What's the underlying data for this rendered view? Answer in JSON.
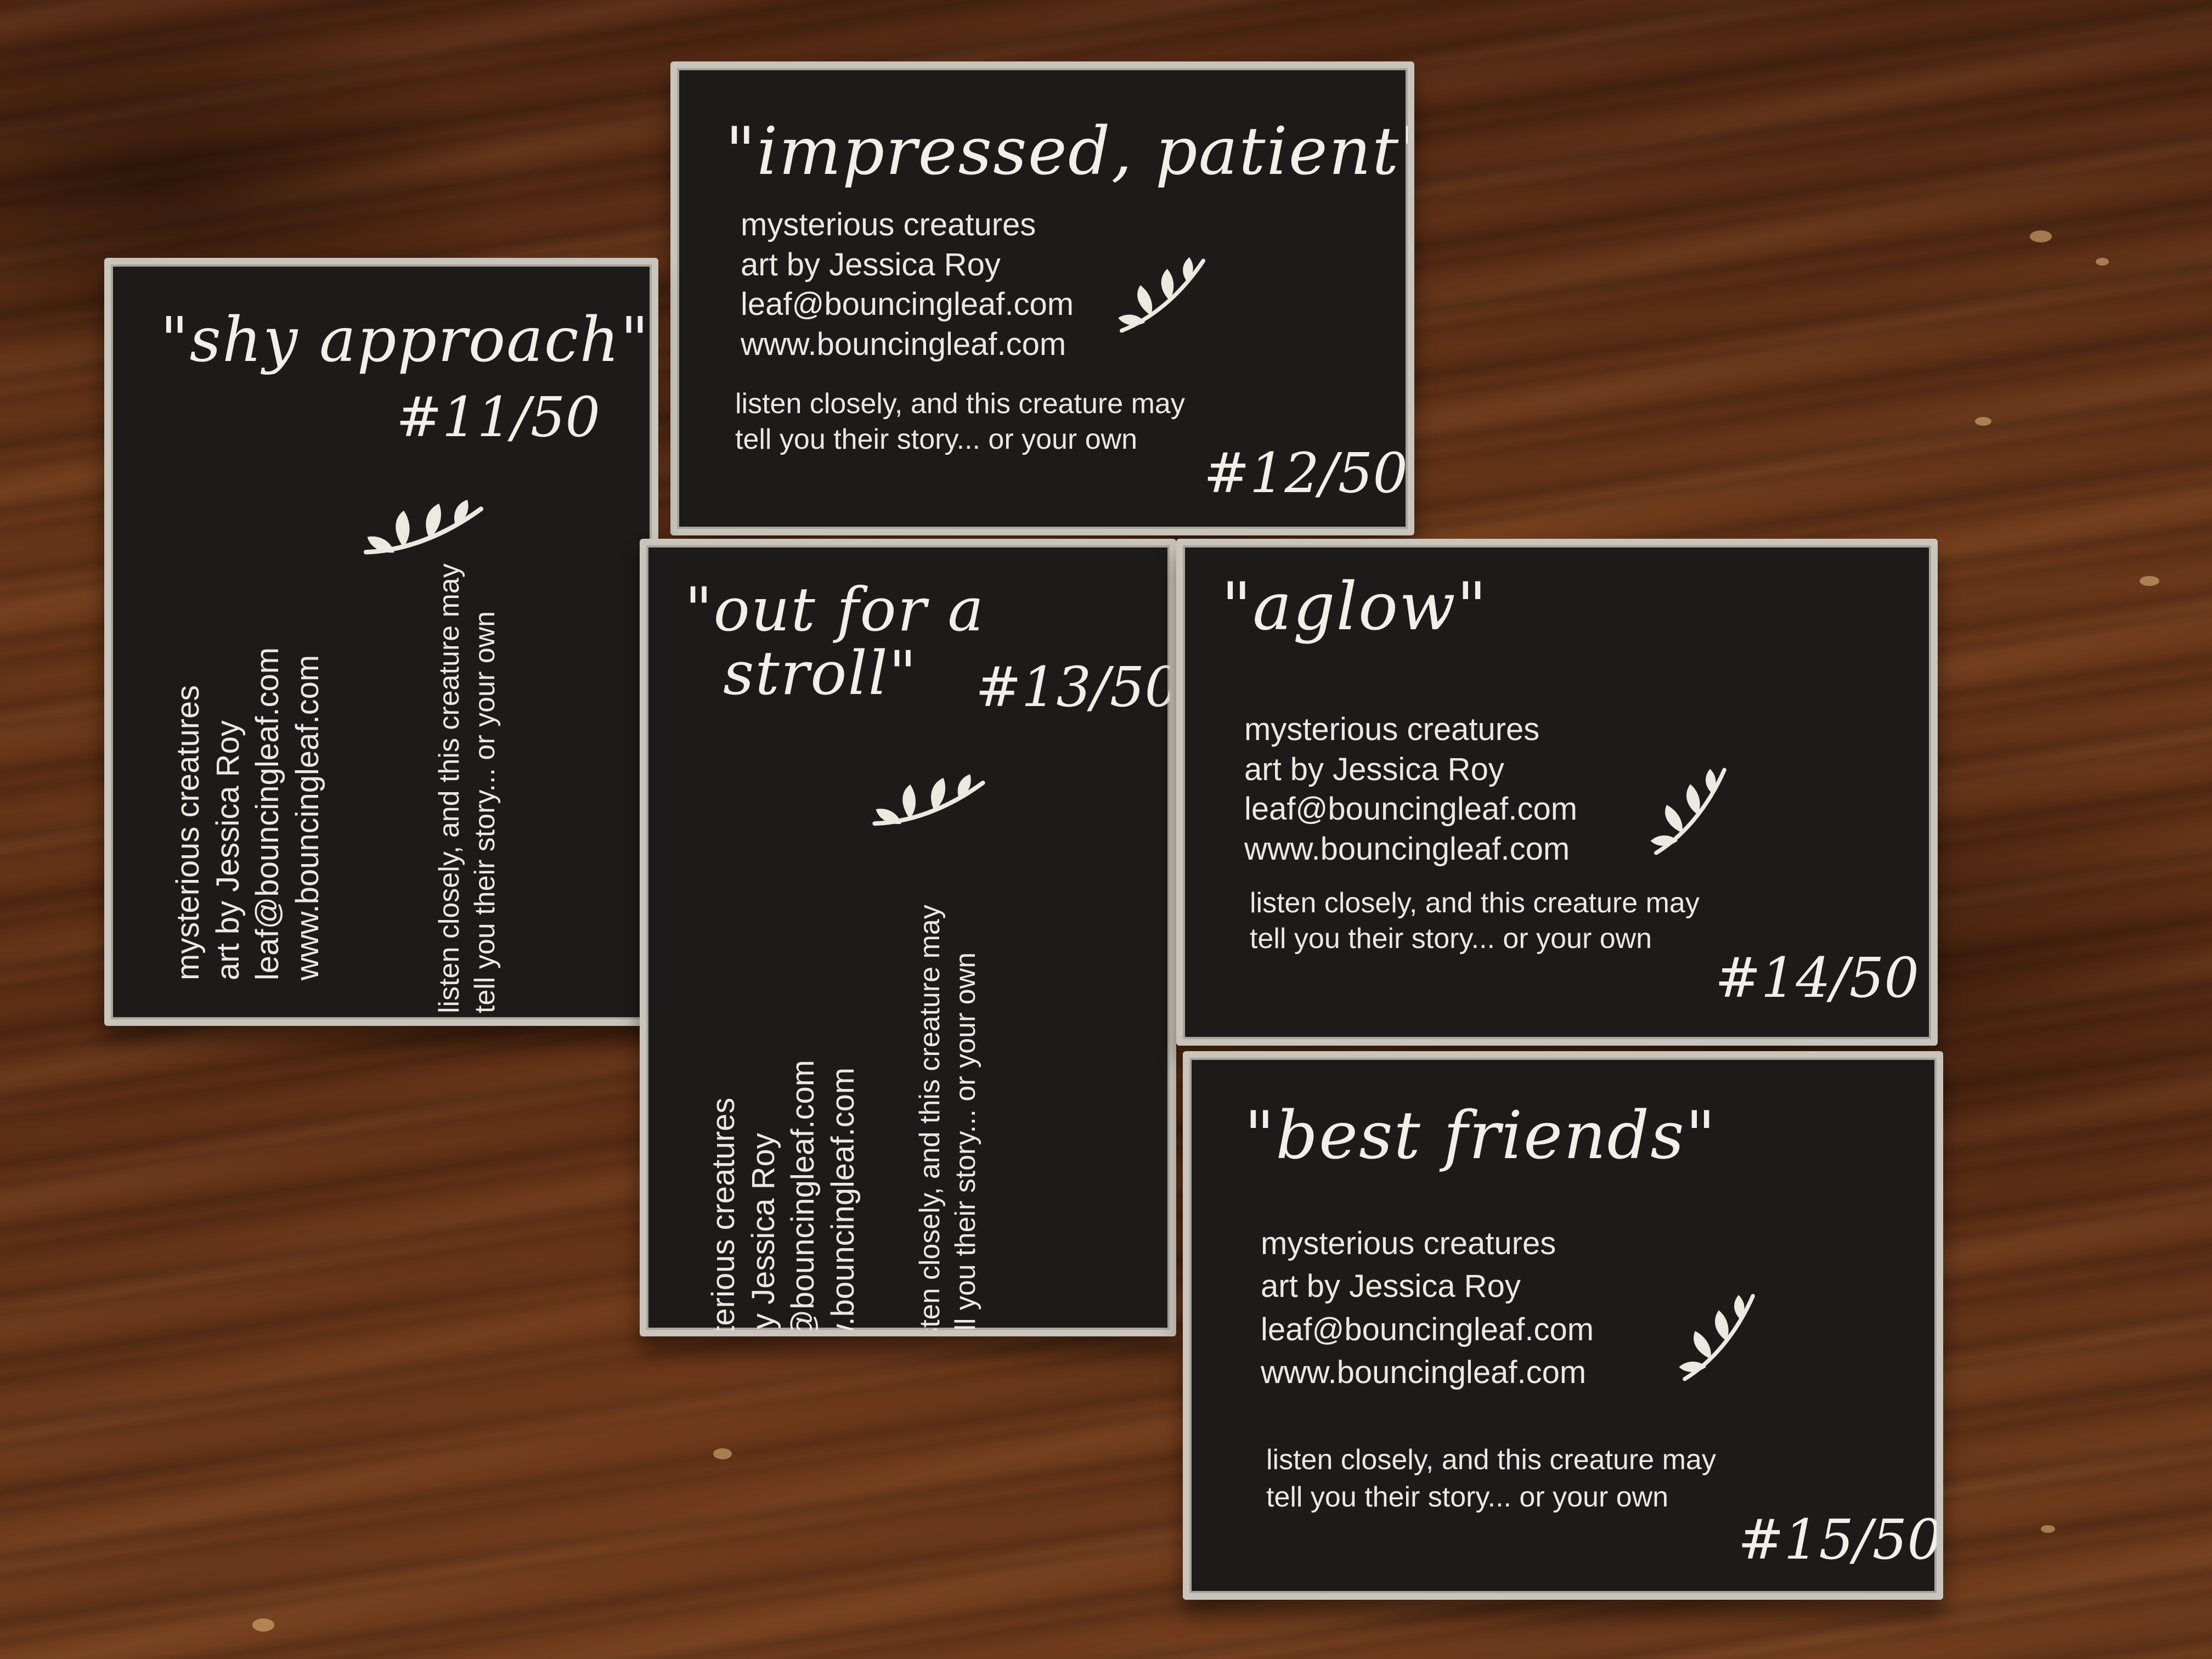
{
  "cards": [
    {
      "title": "\"impressed, patient\"",
      "number": "#12/50",
      "info": [
        "mysterious creatures",
        "art by Jessica Roy",
        "leaf@bouncingleaf.com",
        "www.bouncingleaf.com"
      ],
      "tagline": [
        "listen closely, and this creature may",
        "tell you their story... or your own"
      ]
    },
    {
      "title": "\"shy approach\"",
      "number": "#11/50",
      "info": [
        "mysterious creatures",
        "art by Jessica Roy",
        "leaf@bouncingleaf.com",
        "www.bouncingleaf.com"
      ],
      "tagline": [
        "listen closely, and this creature may",
        "tell you their story... or your own"
      ]
    },
    {
      "title_lines": [
        "\"out for a",
        "stroll\""
      ],
      "number": "#13/50",
      "info": [
        "mysterious creatures",
        "art by Jessica Roy",
        "leaf@bouncingleaf.com",
        "www.bouncingleaf.com"
      ],
      "tagline": [
        "listen closely, and this creature may",
        "tell you their story... or your own"
      ]
    },
    {
      "title": "\"aglow\"",
      "number": "#14/50",
      "info": [
        "mysterious creatures",
        "art by Jessica Roy",
        "leaf@bouncingleaf.com",
        "www.bouncingleaf.com"
      ],
      "tagline": [
        "listen closely, and this creature may",
        "tell you their story... or your own"
      ]
    },
    {
      "title": "\"best friends\"",
      "number": "#15/50",
      "info": [
        "mysterious creatures",
        "art by Jessica Roy",
        "leaf@bouncingleaf.com",
        "www.bouncingleaf.com"
      ],
      "tagline": [
        "listen closely, and this creature may",
        "tell you their story... or your own"
      ]
    }
  ],
  "colors": {
    "card_face": "#1c1b1a",
    "card_edge": "#c9c5bc",
    "ink": "#ece9e1",
    "wood": "#5a2e17"
  },
  "icons": {
    "leaf": "leaf-sprig-icon"
  }
}
